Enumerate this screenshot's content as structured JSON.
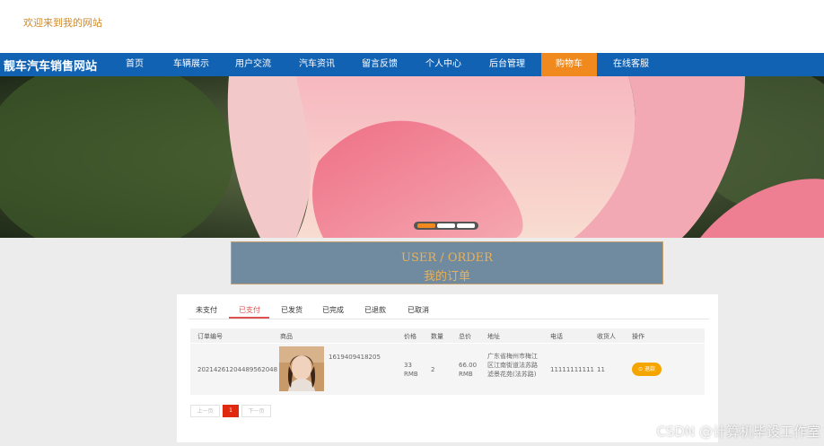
{
  "header": {
    "welcome": "欢迎来到我的网站"
  },
  "nav": {
    "brand": "靓车汽车销售网站",
    "items": [
      {
        "label": "首页"
      },
      {
        "label": "车辆展示"
      },
      {
        "label": "用户交流"
      },
      {
        "label": "汽车资讯"
      },
      {
        "label": "留言反馈"
      },
      {
        "label": "个人中心"
      },
      {
        "label": "后台管理"
      },
      {
        "label": "购物车"
      },
      {
        "label": "在线客服"
      }
    ]
  },
  "section_title": {
    "en": "USER / ORDER",
    "cn": "我的订单"
  },
  "tabs": [
    {
      "label": "未支付"
    },
    {
      "label": "已支付"
    },
    {
      "label": "已发货"
    },
    {
      "label": "已完成"
    },
    {
      "label": "已退款"
    },
    {
      "label": "已取消"
    }
  ],
  "table": {
    "columns": [
      "订单编号",
      "商品",
      "价格",
      "数量",
      "总价",
      "地址",
      "电话",
      "收货人",
      "操作"
    ],
    "rows": [
      {
        "order_no": "20214261204489562048",
        "product": "1619409418205",
        "price": "33 RMB",
        "qty": "2",
        "total": "66.00 RMB",
        "address": "广东省梅州市梅江区江南街道法苏路滤景花苑(法苏路)",
        "phone": "11111111111",
        "receiver": "11",
        "action": "退款"
      }
    ]
  },
  "pagination": {
    "prev": "上一页",
    "current": "1",
    "next": "下一页"
  },
  "watermark": "CSDN @计算机毕设工作室",
  "colors": {
    "nav_bg": "#1262b3",
    "active_nav": "#f08a1e",
    "accent_red": "#e05050",
    "refund_btn": "#f5a500"
  }
}
